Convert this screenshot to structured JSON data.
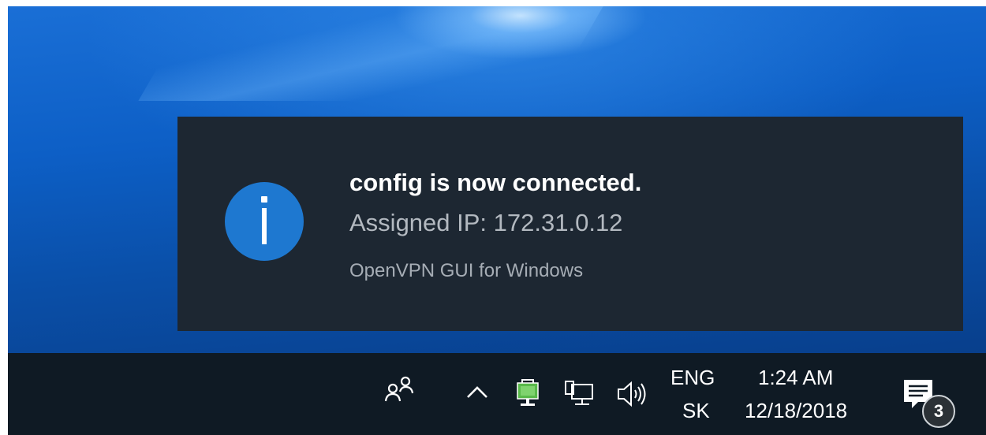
{
  "notification": {
    "title": "config is now connected.",
    "body": "Assigned IP: 172.31.0.12",
    "source": "OpenVPN GUI for Windows",
    "icon": "info-icon",
    "accent_color": "#1e78d0"
  },
  "taskbar": {
    "tray_icons": [
      "people-icon",
      "chevron-up-icon",
      "openvpn-connected-icon",
      "network-icon",
      "volume-icon"
    ],
    "language": "ENG",
    "keyboard_layout": "SK",
    "time": "1:24 AM",
    "date": "12/18/2018",
    "action_center": {
      "icon": "action-center-icon",
      "badge_count": "3"
    }
  }
}
